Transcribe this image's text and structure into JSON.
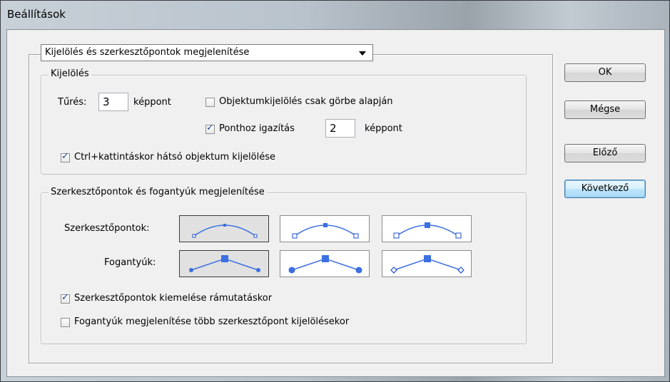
{
  "window": {
    "title": "Beállítások"
  },
  "section_dropdown": {
    "value": "Kijelölés és szerkesztőpontok megjelenítése"
  },
  "selection_group": {
    "legend": "Kijelölés",
    "tolerance_label": "Tűrés:",
    "tolerance_value": "3",
    "tolerance_unit": "képpont",
    "object_select_curve_label": "Objektumkijelölés csak görbe alapján",
    "object_select_curve_checked": false,
    "snap_to_point_label": "Ponthoz igazítás",
    "snap_to_point_checked": true,
    "snap_value": "2",
    "snap_unit": "képpont",
    "ctrl_click_label": "Ctrl+kattintáskor hátsó objektum kijelölése",
    "ctrl_click_checked": true
  },
  "anchor_group": {
    "legend": "Szerkesztőpontok és fogantyúk megjelenítése",
    "anchor_points_label": "Szerkesztőpontok:",
    "handles_label": "Fogantyúk:",
    "highlight_label": "Szerkesztőpontok kiemelése rámutatáskor",
    "highlight_checked": true,
    "show_handles_label": "Fogantyúk megjelenítése több szerkesztőpont kijelölésekor",
    "show_handles_checked": false
  },
  "buttons": {
    "ok": "OK",
    "cancel": "Mégse",
    "previous": "Előző",
    "next": "Következő"
  },
  "colors": {
    "accent": "#3c6fe0",
    "handle_stroke": "#1f4fd1"
  }
}
